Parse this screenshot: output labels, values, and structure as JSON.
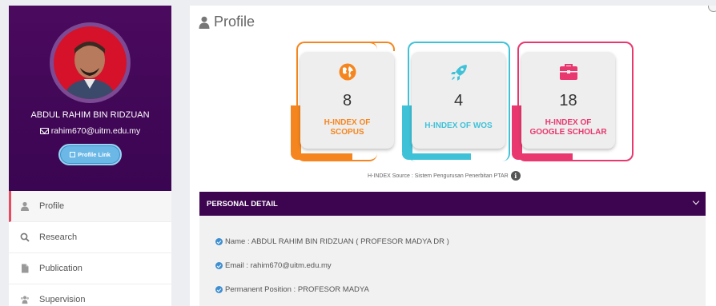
{
  "sidebar": {
    "user_name": "ABDUL RAHIM BIN RIDZUAN",
    "email": "rahim670@uitm.edu.my",
    "profile_link_label": "Profile Link",
    "items": [
      {
        "label": "Profile",
        "icon": "user-icon"
      },
      {
        "label": "Research",
        "icon": "search-icon"
      },
      {
        "label": "Publication",
        "icon": "document-icon"
      },
      {
        "label": "Supervision",
        "icon": "users-icon"
      }
    ]
  },
  "main": {
    "title": "Profile",
    "cards": [
      {
        "value": "8",
        "label_line1": "H-INDEX OF",
        "label_line2": "SCOPUS",
        "icon": "globe-icon",
        "color": "#f5861f"
      },
      {
        "value": "4",
        "label_line1": "H-INDEX OF WOS",
        "label_line2": "",
        "icon": "rocket-icon",
        "color": "#3fc2d8"
      },
      {
        "value": "18",
        "label_line1": "H-INDEX OF",
        "label_line2": "GOOGLE SCHOLAR",
        "icon": "briefcase-icon",
        "color": "#e8386f"
      }
    ],
    "hindex_source": "H-INDEX Source : Sistem Pengurusan Penerbitan PTAR",
    "personal_detail": {
      "header": "PERSONAL DETAIL",
      "rows": [
        "Name : ABDUL RAHIM BIN RIDZUAN ( PROFESOR MADYA DR )",
        "Email : rahim670@uitm.edu.my",
        "Permanent Position : PROFESOR MADYA"
      ]
    }
  },
  "colors": {
    "sidebar_bg": "#4b0a5e",
    "header_bg": "#3d0550",
    "scopus": "#f5861f",
    "wos": "#3fc2d8",
    "google_scholar": "#e8386f"
  }
}
